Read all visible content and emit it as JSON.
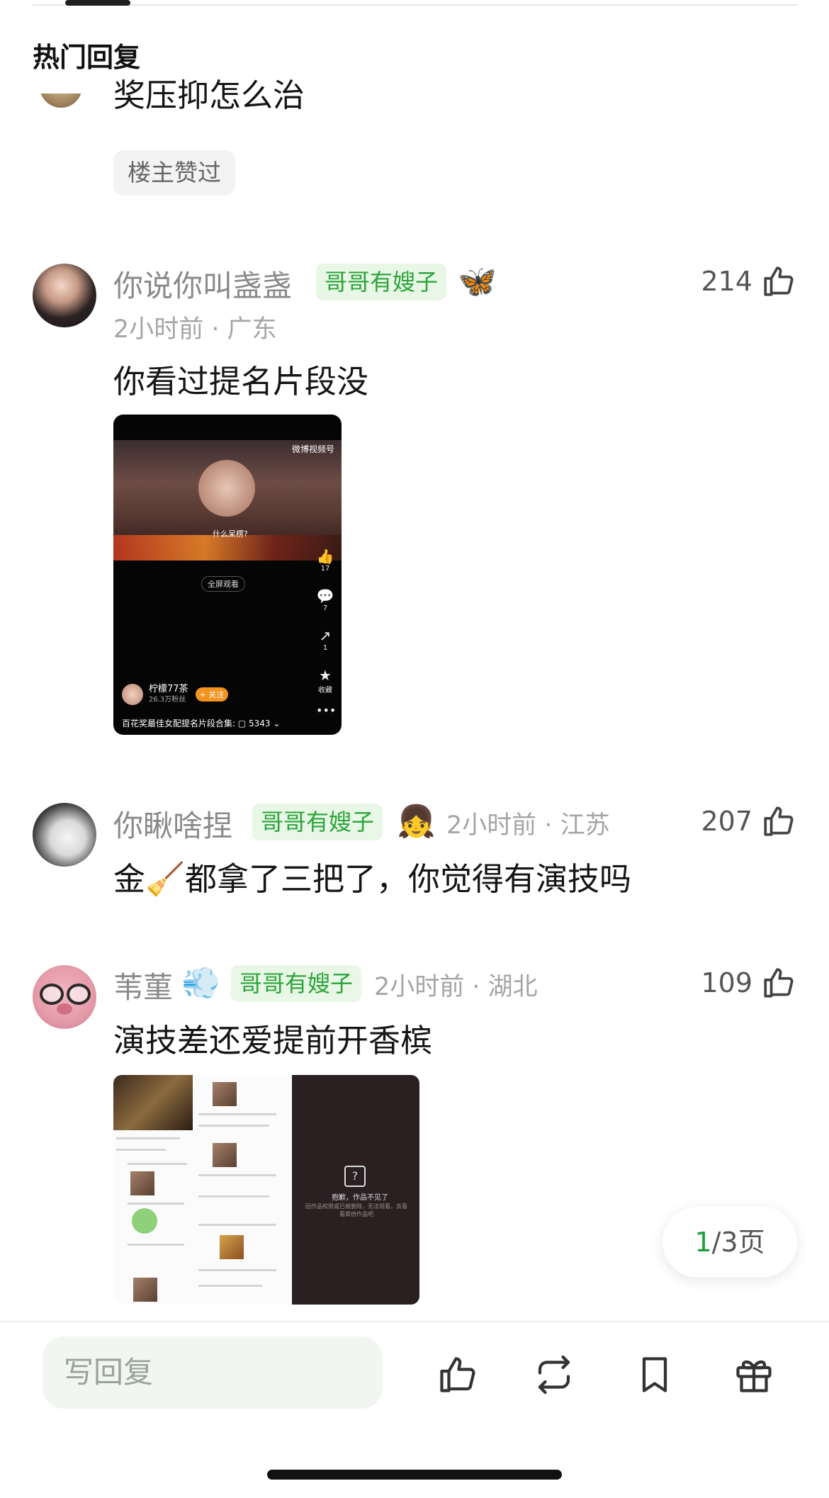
{
  "header": {
    "section_title": "热门回复"
  },
  "top_reply": {
    "text": "奖压抑怎么治",
    "badge": "楼主赞过"
  },
  "comments": [
    {
      "name": "你说你叫盏盏",
      "tag": "哥哥有嫂子",
      "emoji": "🦋",
      "time_location": "2小时前 · 广东",
      "likes": "214",
      "text": "你看过提名片段没",
      "image": {
        "logo": "微博视频号",
        "subtitle": "什么呆楞?",
        "fullscreen": "全屏观看",
        "side_likes": "17",
        "side_comments": "7",
        "side_shares": "1",
        "side_fav": "收藏",
        "user": "柠檬77茶",
        "fans": "26.3万粉丝",
        "follow": "+ 关注",
        "caption": "百花奖最佳女配提名片段合集:  ▢ 5343 ⌄"
      }
    },
    {
      "name": "你瞅啥捏",
      "tag": "哥哥有嫂子",
      "emoji": "👧",
      "time_location": "2小时前 · 江苏",
      "likes": "207",
      "text": "金🧹都拿了三把了，你觉得有演技吗"
    },
    {
      "name": "苇菫",
      "tag": "哥哥有嫂子",
      "emoji": "💨",
      "time_location": "2小时前 · 湖北",
      "likes": "109",
      "text": "演技差还爱提前开香槟",
      "image": {
        "error_title": "抱歉，作品不见了",
        "error_desc": "因作品权限或已被删除，无法观看，去看看其他作品吧"
      }
    }
  ],
  "pagination": {
    "current": "1",
    "rest": "/3页"
  },
  "bottom_bar": {
    "reply_placeholder": "写回复"
  }
}
